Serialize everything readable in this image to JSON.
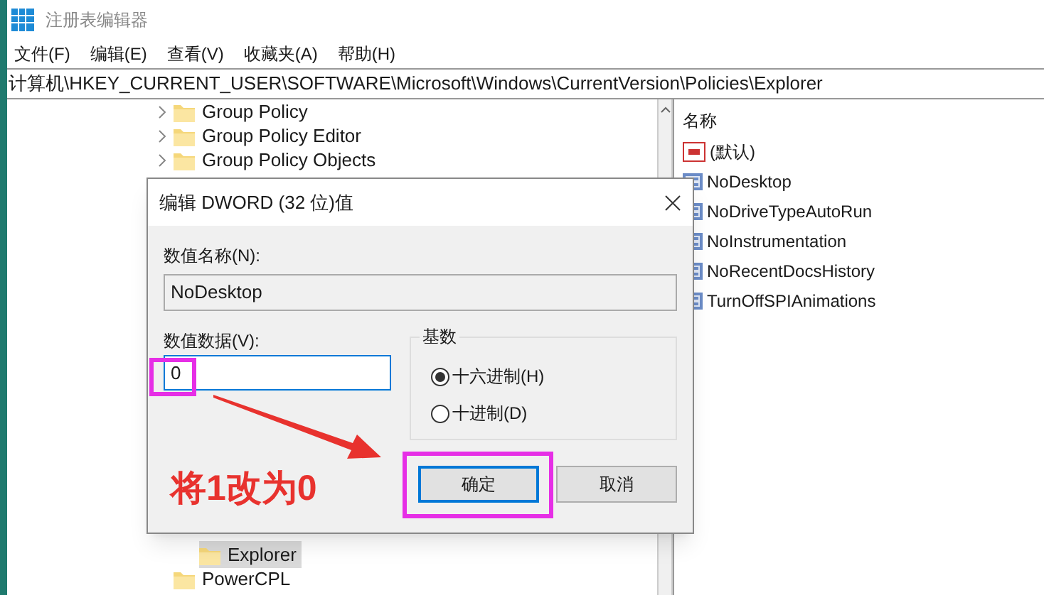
{
  "window": {
    "title": "注册表编辑器"
  },
  "menu": [
    "文件(F)",
    "编辑(E)",
    "查看(V)",
    "收藏夹(A)",
    "帮助(H)"
  ],
  "address": "计算机\\HKEY_CURRENT_USER\\SOFTWARE\\Microsoft\\Windows\\CurrentVersion\\Policies\\Explorer",
  "tree": {
    "items": [
      {
        "label": "Group Policy",
        "expandable": true,
        "selected": false
      },
      {
        "label": "Group Policy Editor",
        "expandable": true,
        "selected": false
      },
      {
        "label": "Group Policy Objects",
        "expandable": true,
        "selected": false
      }
    ],
    "items_below": [
      {
        "children": [
          {
            "label": "Explorer",
            "expandable": false,
            "selected": true
          }
        ]
      },
      {
        "label": "PowerCPL",
        "expandable": false,
        "selected": false
      }
    ]
  },
  "values": {
    "header": "名称",
    "rows": [
      {
        "name": "(默认)",
        "kind": "string"
      },
      {
        "name": "NoDesktop",
        "kind": "dword"
      },
      {
        "name": "NoDriveTypeAutoRun",
        "kind": "dword"
      },
      {
        "name": "NoInstrumentation",
        "kind": "dword"
      },
      {
        "name": "NoRecentDocsHistory",
        "kind": "dword"
      },
      {
        "name": "TurnOffSPIAnimations",
        "kind": "dword"
      }
    ]
  },
  "dialog": {
    "title": "编辑 DWORD (32 位)值",
    "name_label": "数值名称(N):",
    "name_value": "NoDesktop",
    "data_label": "数值数据(V):",
    "data_value": "0",
    "base_title": "基数",
    "radios": [
      {
        "label": "十六进制(H)",
        "selected": true
      },
      {
        "label": "十进制(D)",
        "selected": false
      }
    ],
    "buttons": [
      {
        "label": "确定",
        "default": true
      },
      {
        "label": "取消",
        "default": false
      }
    ]
  },
  "annotation": {
    "text": "将1改为0"
  }
}
